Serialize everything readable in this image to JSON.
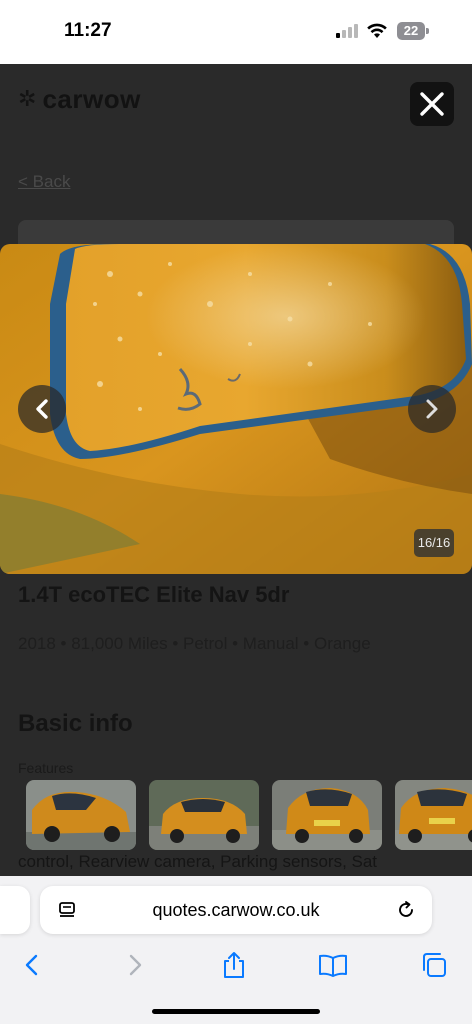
{
  "status_bar": {
    "time": "11:27",
    "battery": "22",
    "signal_bars_active": 1,
    "signal_bars_total": 4
  },
  "page": {
    "logo_text": "carwow",
    "back_link": "< Back",
    "car_title": "1.4T ecoTEC Elite Nav 5dr",
    "specs": "2018 • 81,000 Miles • Petrol • Manual • Orange",
    "basic_info_heading": "Basic info",
    "features_label": "Features",
    "features_text": "control, Rearview camera, Parking sensors, Sat"
  },
  "lightbox": {
    "counter": "16/16",
    "current_index": 16,
    "total": 16,
    "thumbnails": [
      {
        "name": "thumb-1"
      },
      {
        "name": "thumb-2"
      },
      {
        "name": "thumb-3"
      },
      {
        "name": "thumb-4"
      }
    ]
  },
  "browser": {
    "url": "quotes.carwow.co.uk"
  },
  "colors": {
    "car_orange": "#d9951e",
    "overlay": "#1f1f1f",
    "safari_blue": "#0a7aff"
  },
  "icons": {
    "close": "close-icon",
    "prev": "chevron-left-icon",
    "next": "chevron-right-icon",
    "page_menu": "page-menu-icon",
    "reload": "reload-icon",
    "back": "back-icon",
    "forward": "forward-icon",
    "share": "share-icon",
    "bookmarks": "bookmarks-icon",
    "tabs": "tabs-icon"
  }
}
